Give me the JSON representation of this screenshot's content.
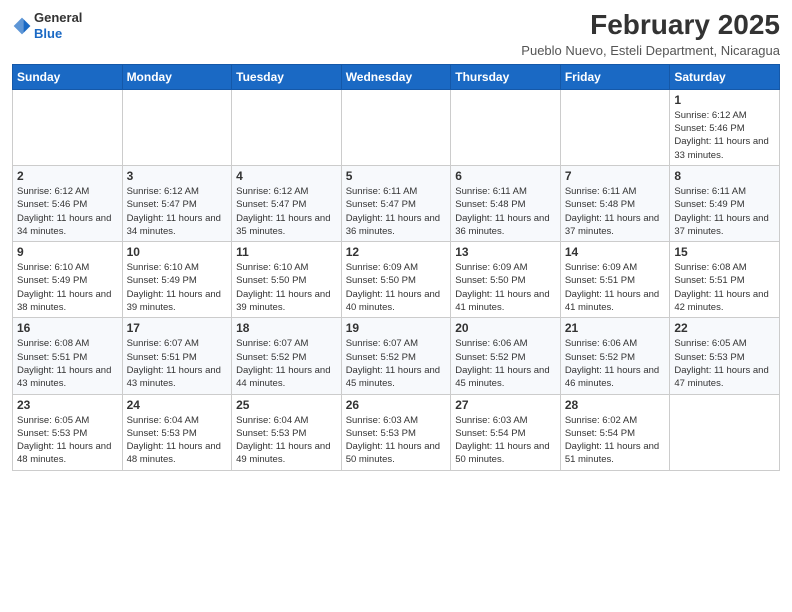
{
  "header": {
    "logo": {
      "general": "General",
      "blue": "Blue"
    },
    "title": "February 2025",
    "location": "Pueblo Nuevo, Esteli Department, Nicaragua"
  },
  "days_of_week": [
    "Sunday",
    "Monday",
    "Tuesday",
    "Wednesday",
    "Thursday",
    "Friday",
    "Saturday"
  ],
  "weeks": [
    [
      {
        "day": "",
        "info": ""
      },
      {
        "day": "",
        "info": ""
      },
      {
        "day": "",
        "info": ""
      },
      {
        "day": "",
        "info": ""
      },
      {
        "day": "",
        "info": ""
      },
      {
        "day": "",
        "info": ""
      },
      {
        "day": "1",
        "info": "Sunrise: 6:12 AM\nSunset: 5:46 PM\nDaylight: 11 hours and 33 minutes."
      }
    ],
    [
      {
        "day": "2",
        "info": "Sunrise: 6:12 AM\nSunset: 5:46 PM\nDaylight: 11 hours and 34 minutes."
      },
      {
        "day": "3",
        "info": "Sunrise: 6:12 AM\nSunset: 5:47 PM\nDaylight: 11 hours and 34 minutes."
      },
      {
        "day": "4",
        "info": "Sunrise: 6:12 AM\nSunset: 5:47 PM\nDaylight: 11 hours and 35 minutes."
      },
      {
        "day": "5",
        "info": "Sunrise: 6:11 AM\nSunset: 5:47 PM\nDaylight: 11 hours and 36 minutes."
      },
      {
        "day": "6",
        "info": "Sunrise: 6:11 AM\nSunset: 5:48 PM\nDaylight: 11 hours and 36 minutes."
      },
      {
        "day": "7",
        "info": "Sunrise: 6:11 AM\nSunset: 5:48 PM\nDaylight: 11 hours and 37 minutes."
      },
      {
        "day": "8",
        "info": "Sunrise: 6:11 AM\nSunset: 5:49 PM\nDaylight: 11 hours and 37 minutes."
      }
    ],
    [
      {
        "day": "9",
        "info": "Sunrise: 6:10 AM\nSunset: 5:49 PM\nDaylight: 11 hours and 38 minutes."
      },
      {
        "day": "10",
        "info": "Sunrise: 6:10 AM\nSunset: 5:49 PM\nDaylight: 11 hours and 39 minutes."
      },
      {
        "day": "11",
        "info": "Sunrise: 6:10 AM\nSunset: 5:50 PM\nDaylight: 11 hours and 39 minutes."
      },
      {
        "day": "12",
        "info": "Sunrise: 6:09 AM\nSunset: 5:50 PM\nDaylight: 11 hours and 40 minutes."
      },
      {
        "day": "13",
        "info": "Sunrise: 6:09 AM\nSunset: 5:50 PM\nDaylight: 11 hours and 41 minutes."
      },
      {
        "day": "14",
        "info": "Sunrise: 6:09 AM\nSunset: 5:51 PM\nDaylight: 11 hours and 41 minutes."
      },
      {
        "day": "15",
        "info": "Sunrise: 6:08 AM\nSunset: 5:51 PM\nDaylight: 11 hours and 42 minutes."
      }
    ],
    [
      {
        "day": "16",
        "info": "Sunrise: 6:08 AM\nSunset: 5:51 PM\nDaylight: 11 hours and 43 minutes."
      },
      {
        "day": "17",
        "info": "Sunrise: 6:07 AM\nSunset: 5:51 PM\nDaylight: 11 hours and 43 minutes."
      },
      {
        "day": "18",
        "info": "Sunrise: 6:07 AM\nSunset: 5:52 PM\nDaylight: 11 hours and 44 minutes."
      },
      {
        "day": "19",
        "info": "Sunrise: 6:07 AM\nSunset: 5:52 PM\nDaylight: 11 hours and 45 minutes."
      },
      {
        "day": "20",
        "info": "Sunrise: 6:06 AM\nSunset: 5:52 PM\nDaylight: 11 hours and 45 minutes."
      },
      {
        "day": "21",
        "info": "Sunrise: 6:06 AM\nSunset: 5:52 PM\nDaylight: 11 hours and 46 minutes."
      },
      {
        "day": "22",
        "info": "Sunrise: 6:05 AM\nSunset: 5:53 PM\nDaylight: 11 hours and 47 minutes."
      }
    ],
    [
      {
        "day": "23",
        "info": "Sunrise: 6:05 AM\nSunset: 5:53 PM\nDaylight: 11 hours and 48 minutes."
      },
      {
        "day": "24",
        "info": "Sunrise: 6:04 AM\nSunset: 5:53 PM\nDaylight: 11 hours and 48 minutes."
      },
      {
        "day": "25",
        "info": "Sunrise: 6:04 AM\nSunset: 5:53 PM\nDaylight: 11 hours and 49 minutes."
      },
      {
        "day": "26",
        "info": "Sunrise: 6:03 AM\nSunset: 5:53 PM\nDaylight: 11 hours and 50 minutes."
      },
      {
        "day": "27",
        "info": "Sunrise: 6:03 AM\nSunset: 5:54 PM\nDaylight: 11 hours and 50 minutes."
      },
      {
        "day": "28",
        "info": "Sunrise: 6:02 AM\nSunset: 5:54 PM\nDaylight: 11 hours and 51 minutes."
      },
      {
        "day": "",
        "info": ""
      }
    ]
  ]
}
